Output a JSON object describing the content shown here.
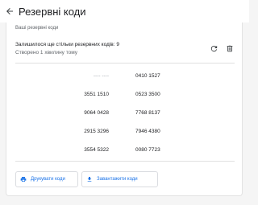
{
  "header": {
    "title": "Резервні коди"
  },
  "card": {
    "section_label": "Ваші резервні коди",
    "remaining_text": "Залишилося ще стільки резервних кодів: 9",
    "created_text": "Створено 1 хвилину тому"
  },
  "codes": [
    {
      "left": "---- ----",
      "right": "0410 1527",
      "left_used": true
    },
    {
      "left": "3551 1510",
      "right": "0523 3500",
      "left_used": false
    },
    {
      "left": "9064 0428",
      "right": "7768 8137",
      "left_used": false
    },
    {
      "left": "2915 3296",
      "right": "7946 4380",
      "left_used": false
    },
    {
      "left": "3554 5322",
      "right": "0080 7723",
      "left_used": false
    }
  ],
  "actions": {
    "print_label": "Друкувати коди",
    "download_label": "Завантажити коди"
  },
  "colors": {
    "accent": "#1a73e8",
    "icon": "#3c4043"
  },
  "icons": {
    "back": "arrow-left-icon",
    "refresh": "refresh-icon",
    "delete": "trash-icon",
    "print": "printer-icon",
    "download": "download-icon"
  }
}
